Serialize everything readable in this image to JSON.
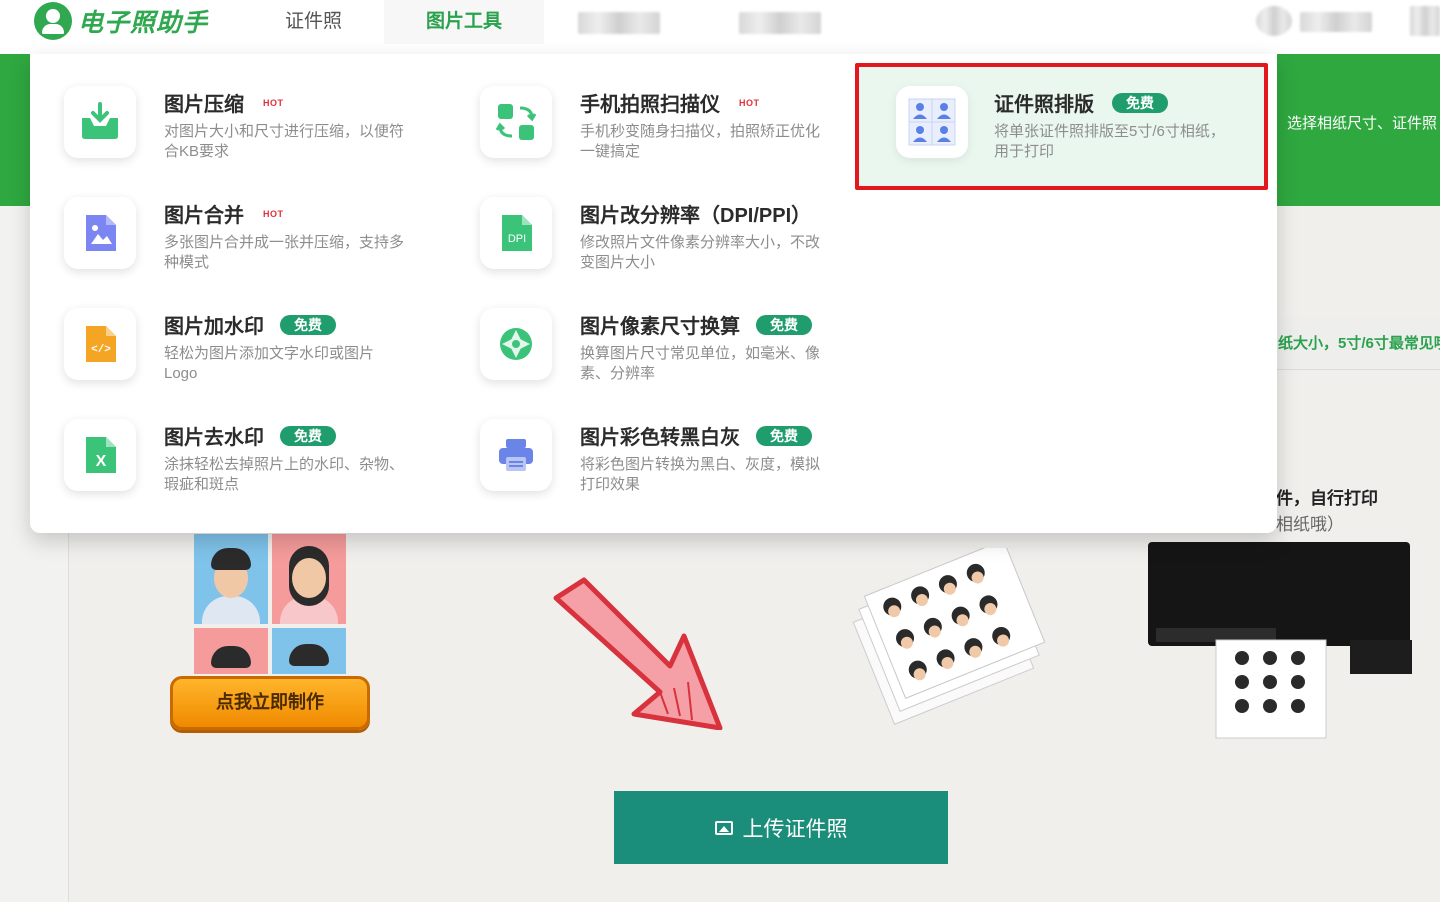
{
  "app": {
    "logo_text": "电子照助手",
    "brand_color": "#2fa84f"
  },
  "nav": {
    "items": [
      {
        "label": "证件照",
        "active": false
      },
      {
        "label": "图片工具",
        "active": true
      }
    ]
  },
  "banner": {
    "text": "，选择相纸尺寸、证件照"
  },
  "page": {
    "info_text": "纸大小，5寸/6寸最常见哦",
    "step_text_1": "件，自行打印",
    "step_text_2": "相纸哦）",
    "make_button_label": "点我立即制作",
    "upload_button_label": "上传证件照",
    "upload_button_color": "#1a8e7a"
  },
  "dropdown": {
    "tools": [
      {
        "id": "compress",
        "title": "图片压缩",
        "badge": "HOT",
        "desc": "对图片大小和尺寸进行压缩，以便符合KB要求",
        "icon": "download-tray-icon"
      },
      {
        "id": "scanner",
        "title": "手机拍照扫描仪",
        "badge": "HOT",
        "desc": "手机秒变随身扫描仪，拍照矫正优化一键搞定",
        "icon": "scan-convert-icon"
      },
      {
        "id": "layout",
        "title": "证件照排版",
        "badge": "免费",
        "desc": "将单张证件照排版至5寸/6寸相纸，用于打印",
        "icon": "id-photo-grid-icon",
        "highlighted": true
      },
      {
        "id": "merge",
        "title": "图片合并",
        "badge": "HOT",
        "desc": "多张图片合并成一张并压缩，支持多种模式",
        "icon": "image-file-icon"
      },
      {
        "id": "dpi",
        "title": "图片改分辨率（DPI/PPI）",
        "badge": "",
        "desc": "修改照片文件像素分辨率大小，不改变图片大小",
        "icon": "dpi-file-icon",
        "icon_text": "DPI"
      },
      {
        "id": "watermark",
        "title": "图片加水印",
        "badge": "免费",
        "desc": "轻松为图片添加文字水印或图片Logo",
        "icon": "code-file-icon",
        "icon_text": "</>"
      },
      {
        "id": "pixel",
        "title": "图片像素尺寸换算",
        "badge": "免费",
        "desc": "换算图片尺寸常见单位，如毫米、像素、分辨率",
        "icon": "aperture-icon"
      },
      {
        "id": "remove-watermark",
        "title": "图片去水印",
        "badge": "免费",
        "desc": "涂抹轻松去掉照片上的水印、杂物、瑕疵和斑点",
        "icon": "excel-file-icon",
        "icon_text": "X"
      },
      {
        "id": "grayscale",
        "title": "图片彩色转黑白灰",
        "badge": "免费",
        "desc": "将彩色图片转换为黑白、灰度，模拟打印效果",
        "icon": "printer-icon"
      }
    ]
  },
  "colors": {
    "free_badge": "#1f9d6c",
    "hot_badge": "#e0303a",
    "highlight_frame": "#e3171e",
    "banner": "#2fa840"
  }
}
